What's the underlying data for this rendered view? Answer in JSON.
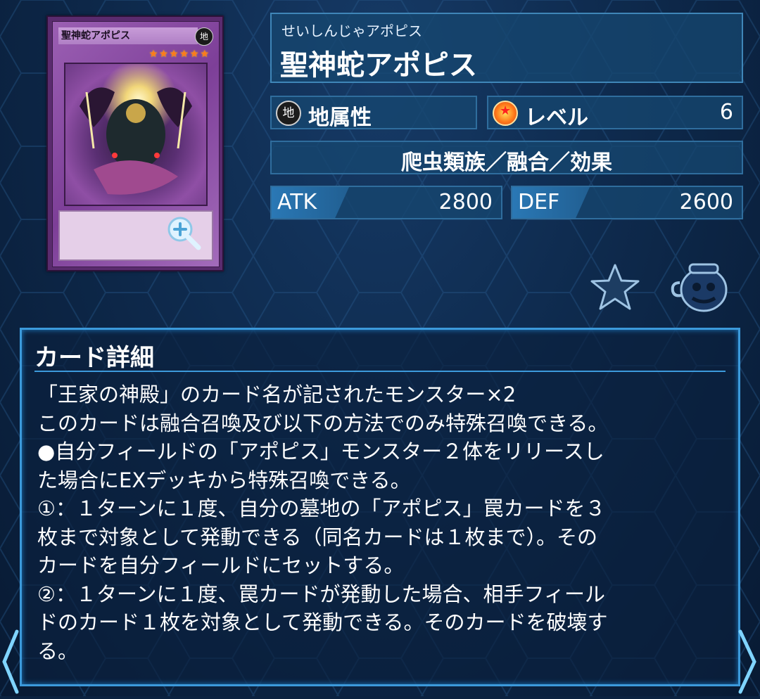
{
  "card": {
    "image_name": "聖神蛇アポピス",
    "image_attribute": "地",
    "image_stars": "★★★★★★"
  },
  "header": {
    "kana": "せいしんじゃアポピス",
    "name": "聖神蛇アポピス"
  },
  "attribute": {
    "icon_glyph": "地",
    "label": "地属性"
  },
  "level": {
    "label": "レベル",
    "value": "6"
  },
  "type_line": "爬虫類族／融合／効果",
  "stats": {
    "atk_label": "ATK",
    "atk_value": "2800",
    "def_label": "DEF",
    "def_value": "2600"
  },
  "detail": {
    "title": "カード詳細",
    "text": "「王家の神殿」のカード名が記されたモンスター×2\nこのカードは融合召喚及び以下の方法でのみ特殊召喚できる。\n●自分フィールドの「アポピス」モンスター２体をリリースし\nた場合にEXデッキから特殊召喚できる。\n①：１ターンに１度、自分の墓地の「アポピス」罠カードを３\n枚まで対象として発動できる（同名カードは１枚まで）。その\nカードを自分フィールドにセットする。\n②：１ターンに１度、罠カードが発動した場合、相手フィール\nドのカード１枚を対象として発動できる。そのカードを破壊す\nる。"
  },
  "colors": {
    "background": "#0b2240",
    "panel": "#164670",
    "accent": "#3c9adb",
    "card_frame": "#7d3f98"
  },
  "icons": {
    "zoom": "zoom-in-icon",
    "favorite": "star-icon",
    "deck": "jar-icon",
    "prev": "chevron-left-icon",
    "next": "chevron-right-icon"
  }
}
